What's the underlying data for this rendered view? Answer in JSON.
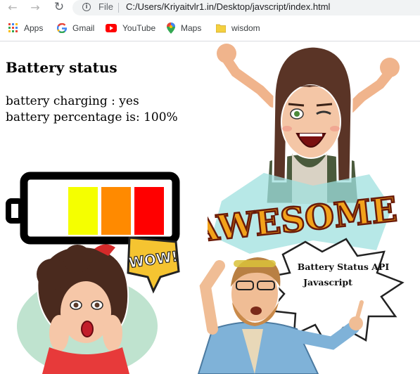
{
  "browser": {
    "scheme_label": "File",
    "url": "C:/Users/Kriyaitvlr1.in/Desktop/javscript/index.html",
    "bookmarks": [
      {
        "label": "Apps",
        "icon": "apps-grid-icon"
      },
      {
        "label": "Gmail",
        "icon": "google-icon"
      },
      {
        "label": "YouTube",
        "icon": "youtube-icon"
      },
      {
        "label": "Maps",
        "icon": "maps-icon"
      },
      {
        "label": "wisdom",
        "icon": "folder-icon"
      }
    ]
  },
  "page": {
    "heading": "Battery status",
    "charging_line": "battery charging : yes",
    "percentage_line": "battery percentage is: 100%"
  },
  "illustration": {
    "wow_bubble": "WOW!",
    "awesome_text": "AWESOME!",
    "burst_line1": "Battery Status API",
    "burst_line2": "Javascript"
  },
  "colors": {
    "battery_segments": [
      "#f5ff00",
      "#ff8a00",
      "#ff0000"
    ],
    "battery_outline": "#000000"
  }
}
